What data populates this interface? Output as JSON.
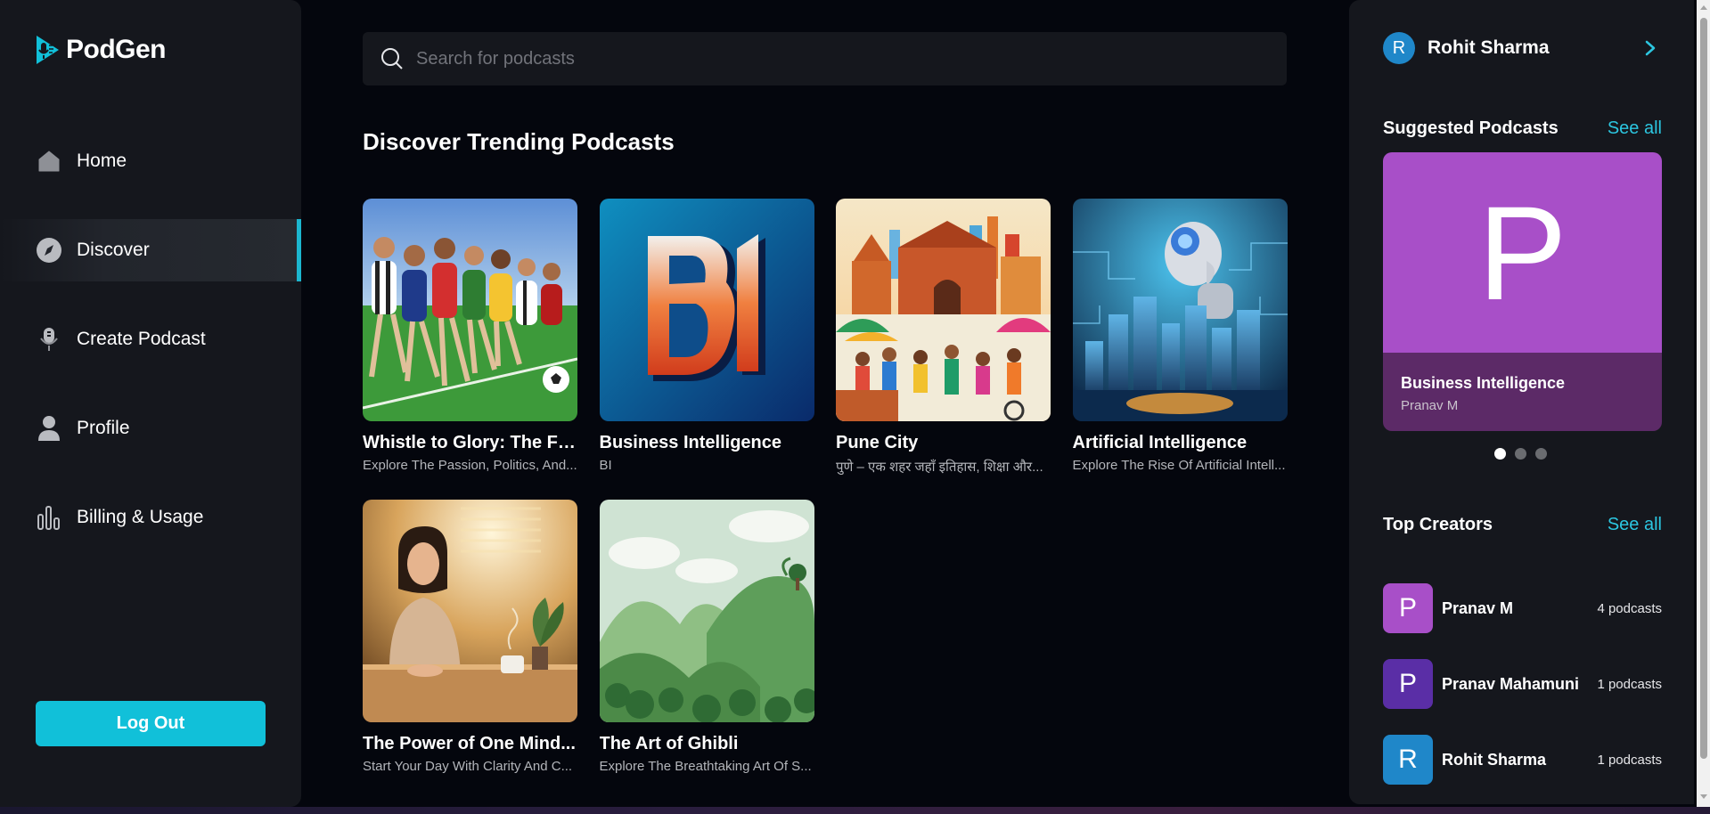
{
  "app": {
    "name": "PodGen"
  },
  "sidebar": {
    "items": [
      {
        "label": "Home",
        "icon": "home-icon",
        "active": false
      },
      {
        "label": "Discover",
        "icon": "compass-icon",
        "active": true
      },
      {
        "label": "Create Podcast",
        "icon": "microphone-icon",
        "active": false
      },
      {
        "label": "Profile",
        "icon": "user-icon",
        "active": false
      },
      {
        "label": "Billing & Usage",
        "icon": "bar-chart-icon",
        "active": false
      }
    ],
    "logout_label": "Log Out"
  },
  "search": {
    "placeholder": "Search for podcasts",
    "value": ""
  },
  "main": {
    "section_title": "Discover Trending Podcasts",
    "podcasts": [
      {
        "title": "Whistle to Glory: The Fl...",
        "description": "Explore The Passion, Politics, And..."
      },
      {
        "title": "Business Intelligence",
        "description": "BI"
      },
      {
        "title": "Pune City",
        "description": "पुणे – एक शहर जहाँ इतिहास, शिक्षा और..."
      },
      {
        "title": "Artificial Intelligence",
        "description": "Explore The Rise Of Artificial Intell..."
      },
      {
        "title": "The Power of One Mind...",
        "description": "Start Your Day With Clarity And C..."
      },
      {
        "title": "The Art of Ghibli",
        "description": "Explore The Breathtaking Art Of S..."
      }
    ]
  },
  "user": {
    "initial": "R",
    "name": "Rohit Sharma"
  },
  "suggested": {
    "heading": "Suggested Podcasts",
    "see_all": "See all",
    "card": {
      "letter": "P",
      "title": "Business Intelligence",
      "author": "Pranav M",
      "color": "#a84fc8"
    },
    "slide_count": 3,
    "active_slide": 1
  },
  "top_creators": {
    "heading": "Top Creators",
    "see_all": "See all",
    "items": [
      {
        "initial": "P",
        "name": "Pranav M",
        "count": "4 podcasts",
        "color": "#a84fc8"
      },
      {
        "initial": "P",
        "name": "Pranav Mahamuni",
        "count": "1 podcasts",
        "color": "#5a2ea6"
      },
      {
        "initial": "R",
        "name": "Rohit Sharma",
        "count": "1 podcasts",
        "color": "#1f87c9"
      }
    ]
  },
  "colors": {
    "accent": "#11c0d9",
    "background": "#04060d",
    "panel": "#15171d"
  }
}
